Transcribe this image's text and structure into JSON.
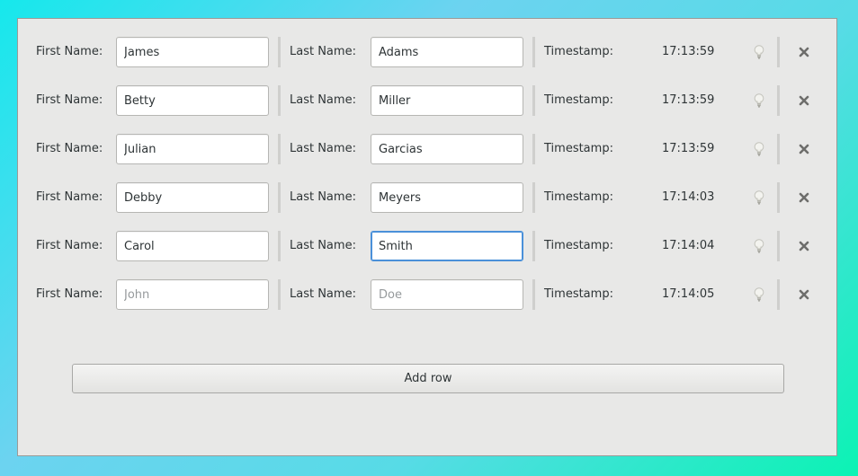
{
  "labels": {
    "first_name": "First Name:",
    "last_name": "Last Name:",
    "timestamp": "Timestamp:"
  },
  "rows": [
    {
      "first": "James",
      "last": "Adams",
      "time": "17:13:59"
    },
    {
      "first": "Betty",
      "last": "Miller",
      "time": "17:13:59"
    },
    {
      "first": "Julian",
      "last": "Garcias",
      "time": "17:13:59"
    },
    {
      "first": "Debby",
      "last": "Meyers",
      "time": "17:14:03"
    },
    {
      "first": "Carol",
      "last": "Smith",
      "time": "17:14:04"
    },
    {
      "first": "",
      "last": "",
      "first_placeholder": "John",
      "last_placeholder": "Doe",
      "time": "17:14:05"
    }
  ],
  "focused_field": "rows.4.last",
  "add_button": {
    "label": "Add row"
  },
  "icons": {
    "status": "lightbulb-icon",
    "remove": "close-icon"
  },
  "colors": {
    "focus": "#4a90d9",
    "window_bg": "#e8e8e7"
  }
}
